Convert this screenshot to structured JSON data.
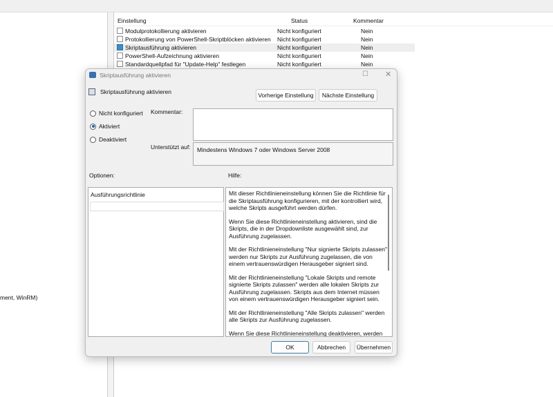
{
  "left_pane": {
    "fragment": "ment, WinRM)"
  },
  "list": {
    "columns": [
      "Einstellung",
      "Status",
      "Kommentar"
    ],
    "rows": [
      {
        "name": "Modulprotokollierung aktivieren",
        "status": "Nicht konfiguriert",
        "comment": "Nein"
      },
      {
        "name": "Protokollierung von PowerShell-Skriptblöcken aktivieren",
        "status": "Nicht konfiguriert",
        "comment": "Nein"
      },
      {
        "name": "Skriptausführung aktivieren",
        "status": "Nicht konfiguriert",
        "comment": "Nein"
      },
      {
        "name": "PowerShell-Aufzeichnung aktivieren",
        "status": "Nicht konfiguriert",
        "comment": "Nein"
      },
      {
        "name": "Standardquellpfad für \"Update-Help\" festlegen",
        "status": "Nicht konfiguriert",
        "comment": "Nein"
      }
    ]
  },
  "dialog": {
    "title": "Skriptausführung aktivieren",
    "heading": "Skriptausführung aktivieren",
    "prev": "Vorherige Einstellung",
    "next": "Nächste Einstellung",
    "radios": [
      "Nicht konfiguriert",
      "Aktiviert",
      "Deaktiviert"
    ],
    "selected": "Aktiviert",
    "comment_label": "Kommentar:",
    "supported_label": "Unterstützt auf:",
    "supported_value": "Mindestens Windows 7 oder Windows Server 2008",
    "options_label": "Optionen:",
    "help_label": "Hilfe:",
    "option_name": "Ausführungsrichtlinie",
    "help": [
      "Mit dieser Richtlinieneinstellung können Sie die Richtlinie für die Skriptausführung konfigurieren, mit der kontrolliert wird, welche Skripts ausgeführt werden dürfen.",
      "Wenn Sie diese Richtlinieneinstellung aktivieren, sind die Skripts, die in der Dropdownliste ausgewählt sind, zur Ausführung zugelassen.",
      "Mit der Richtlinieneinstellung \"Nur signierte Skripts zulassen\" werden nur Skripts zur Ausführung zugelassen, die von einem vertrauenswürdigen Herausgeber signiert sind.",
      "Mit der Richtlinieneinstellung \"Lokale Skripts und remote signierte Skripts zulassen\" werden alle lokalen Skripts zur Ausführung zugelassen. Skripts aus dem Internet müssen von einem vertrauenswürdigen Herausgeber signiert sein.",
      "Mit der Richtlinieneinstellung \"Alle Skripts zulassen\" werden alle Skripts zur Ausführung zugelassen.",
      "Wenn Sie diese Richtlinieneinstellung deaktivieren, werden keine Skripts zur Ausführung zugelassen."
    ],
    "ok": "OK",
    "cancel": "Abbrechen",
    "apply": "Übernehmen"
  }
}
